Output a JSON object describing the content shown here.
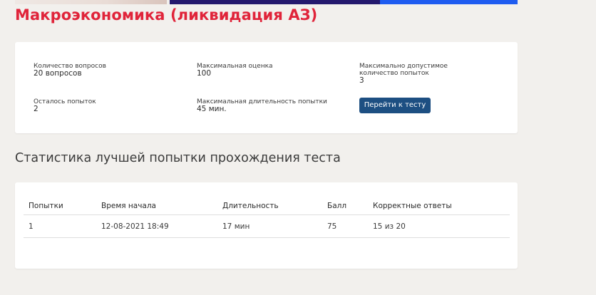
{
  "course": {
    "title": "Макроэкономика (ликвидация АЗ)"
  },
  "quiz_info": {
    "questions_label": "Количество вопросов",
    "questions_value": "20 вопросов",
    "max_score_label": "Максимальная оценка",
    "max_score_value": "100",
    "max_attempts_label": "Максимально допустимое количество попыток",
    "max_attempts_value": "3",
    "remaining_label": "Осталось попыток",
    "remaining_value": "2",
    "max_duration_label": "Максимальная длительность попытки",
    "max_duration_value": "45 мин.",
    "go_button_label": "Перейти к тесту"
  },
  "stats": {
    "title": "Статистика лучшей попытки прохождения теста",
    "headers": {
      "attempt": "Попытки",
      "start": "Время начала",
      "duration": "Длительность",
      "score": "Балл",
      "correct": "Корректные ответы"
    },
    "rows": [
      {
        "attempt": "1",
        "start": "12-08-2021 18:49",
        "duration": "17 мин",
        "score": "75",
        "correct": "15 из 20"
      }
    ]
  },
  "colors": {
    "title_red": "#e0243a",
    "button_blue": "#1d4f82",
    "background": "#f2f0ed"
  }
}
